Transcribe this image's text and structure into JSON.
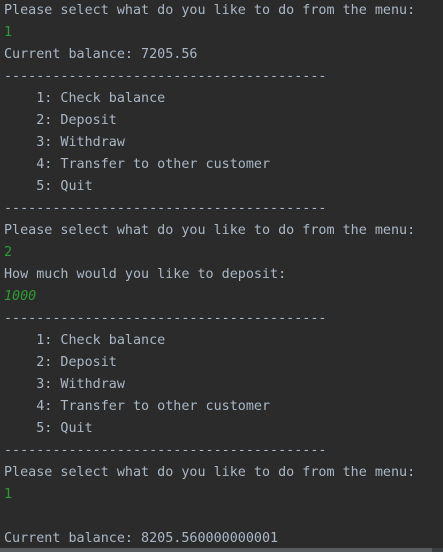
{
  "console": {
    "colors": {
      "background": "#2b2b2b",
      "output_text": "#a9b7c6",
      "input_text": "#2e9c35"
    },
    "lines": [
      {
        "text": "Please select what do you like to do from the menu:",
        "kind": "output"
      },
      {
        "text": "1",
        "kind": "input"
      },
      {
        "text": "Current balance: 7205.56",
        "kind": "output"
      },
      {
        "text": "----------------------------------------",
        "kind": "output"
      },
      {
        "text": "    1: Check balance",
        "kind": "output"
      },
      {
        "text": "    2: Deposit",
        "kind": "output"
      },
      {
        "text": "    3: Withdraw",
        "kind": "output"
      },
      {
        "text": "    4: Transfer to other customer",
        "kind": "output"
      },
      {
        "text": "    5: Quit",
        "kind": "output"
      },
      {
        "text": "----------------------------------------",
        "kind": "output"
      },
      {
        "text": "Please select what do you like to do from the menu:",
        "kind": "output"
      },
      {
        "text": "2",
        "kind": "input"
      },
      {
        "text": "How much would you like to deposit:",
        "kind": "output"
      },
      {
        "text": "1000",
        "kind": "input-italic"
      },
      {
        "text": "----------------------------------------",
        "kind": "output"
      },
      {
        "text": "    1: Check balance",
        "kind": "output"
      },
      {
        "text": "    2: Deposit",
        "kind": "output"
      },
      {
        "text": "    3: Withdraw",
        "kind": "output"
      },
      {
        "text": "    4: Transfer to other customer",
        "kind": "output"
      },
      {
        "text": "    5: Quit",
        "kind": "output"
      },
      {
        "text": "----------------------------------------",
        "kind": "output"
      },
      {
        "text": "Please select what do you like to do from the menu:",
        "kind": "output"
      },
      {
        "text": "1",
        "kind": "input"
      },
      {
        "text": "",
        "kind": "output"
      },
      {
        "text": "Current balance: 8205.560000000001",
        "kind": "output"
      }
    ]
  }
}
